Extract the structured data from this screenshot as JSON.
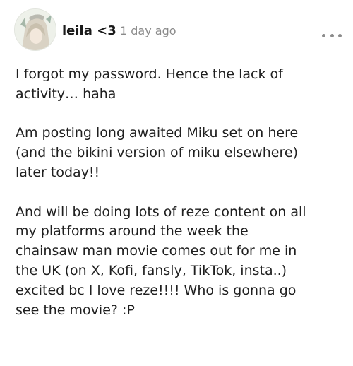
{
  "post": {
    "author": "leila <3",
    "timestamp": "1 day ago",
    "menu_icon": "more-horizontal-icon",
    "paragraphs": [
      {
        "lines": [
          "I forgot my password. Hence the lack of",
          "activity… haha"
        ]
      },
      {
        "lines": [
          "Am posting long awaited Miku set on here",
          "(and the bikini version of miku elsewhere)",
          "later today!!"
        ]
      },
      {
        "lines": [
          "And will be doing lots of reze content on all",
          "my platforms around the week the",
          "chainsaw man movie comes out for me in",
          "the UK (on X, Kofi, fansly, TikTok, insta..)",
          "excited bc I love reze!!!! Who is gonna go",
          "see the movie? :P"
        ]
      }
    ]
  }
}
